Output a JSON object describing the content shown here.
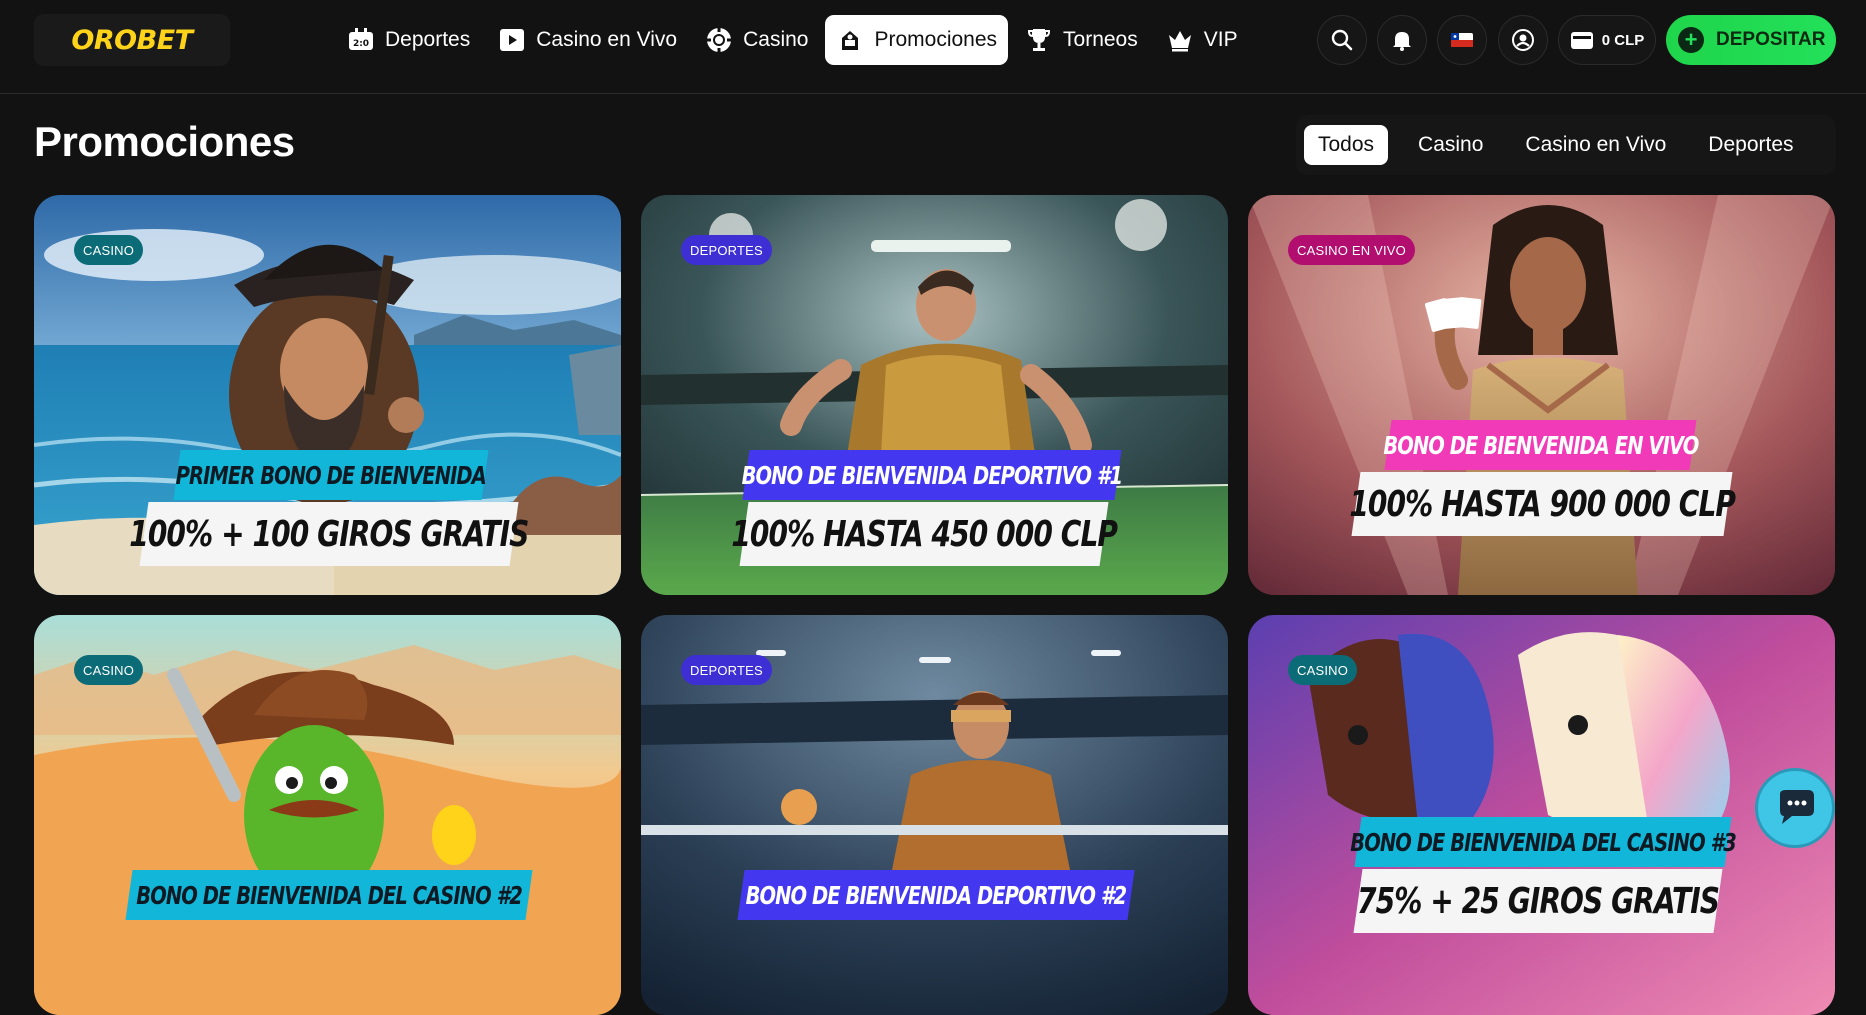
{
  "brand": {
    "logo": "OROBET"
  },
  "nav": {
    "items": [
      {
        "label": "Deportes",
        "icon": "scoreboard-icon"
      },
      {
        "label": "Casino en Vivo",
        "icon": "play-icon"
      },
      {
        "label": "Casino",
        "icon": "casino-chip-icon"
      },
      {
        "label": "Promociones",
        "icon": "gift-icon",
        "active": true
      },
      {
        "label": "Torneos",
        "icon": "trophy-icon"
      },
      {
        "label": "VIP",
        "icon": "crown-icon"
      }
    ]
  },
  "header": {
    "balance": "0 CLP",
    "deposit_label": "DEPOSITAR",
    "icons": [
      "search-icon",
      "bell-icon",
      "chile-flag-icon",
      "user-icon",
      "wallet-icon"
    ]
  },
  "page": {
    "title": "Promociones"
  },
  "filters": [
    {
      "label": "Todos",
      "active": true
    },
    {
      "label": "Casino"
    },
    {
      "label": "Casino en Vivo"
    },
    {
      "label": "Deportes"
    }
  ],
  "promos": [
    {
      "badge": "CASINO",
      "top": "PRIMER BONO DE BIENVENIDA",
      "bottom": "100% + 100 GIROS GRATIS"
    },
    {
      "badge": "DEPORTES",
      "top": "BONO DE BIENVENIDA DEPORTIVO #1",
      "bottom": "100% HASTA 450 000 CLP"
    },
    {
      "badge": "CASINO EN VIVO",
      "top": "BONO DE BIENVENIDA EN VIVO",
      "bottom": "100% HASTA 900 000 CLP"
    },
    {
      "badge": "CASINO",
      "top": "BONO DE BIENVENIDA DEL CASINO #2",
      "bottom": ""
    },
    {
      "badge": "DEPORTES",
      "top": "BONO DE BIENVENIDA DEPORTIVO #2",
      "bottom": ""
    },
    {
      "badge": "CASINO",
      "top": "BONO DE BIENVENIDA DEL CASINO #3",
      "bottom": "75% + 25 GIROS GRATIS"
    }
  ],
  "colors": {
    "accent_yellow": "#ffd319",
    "deposit_green": "#22dd55",
    "casino_badge": "#0b6c78",
    "sports_badge": "#3d2fd4",
    "live_badge": "#b10e70",
    "banner_cyan": "#12b6d8",
    "banner_blue": "#4338f0",
    "banner_pink": "#f03ab8"
  }
}
